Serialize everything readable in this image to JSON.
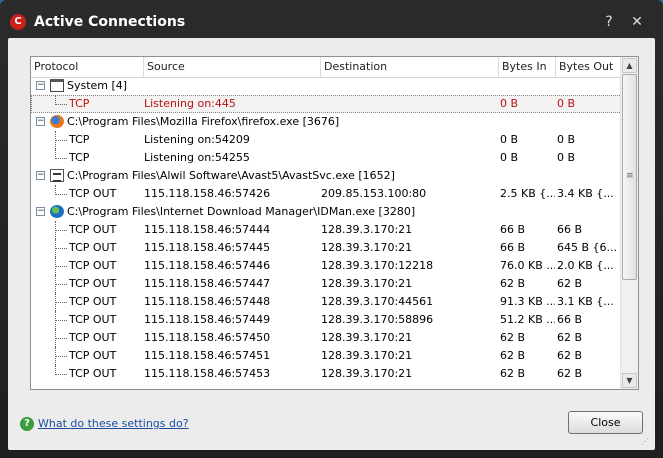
{
  "window": {
    "title": "Active Connections",
    "app_icon": "comodo-c-icon"
  },
  "columns": [
    "Protocol",
    "Source",
    "Destination",
    "Bytes In",
    "Bytes Out"
  ],
  "groups": [
    {
      "icon": "window-icon",
      "name": "System [4]",
      "rows": [
        {
          "protocol": "TCP",
          "source": "Listening on:445",
          "destination": "",
          "bytes_in": "0 B",
          "bytes_out": "0 B",
          "selected": true
        }
      ]
    },
    {
      "icon": "firefox-icon",
      "name": "C:\\Program Files\\Mozilla Firefox\\firefox.exe [3676]",
      "rows": [
        {
          "protocol": "TCP",
          "source": "Listening on:54209",
          "destination": "",
          "bytes_in": "0 B",
          "bytes_out": "0 B"
        },
        {
          "protocol": "TCP",
          "source": "Listening on:54255",
          "destination": "",
          "bytes_in": "0 B",
          "bytes_out": "0 B"
        }
      ]
    },
    {
      "icon": "avast-icon",
      "name": "C:\\Program Files\\Alwil Software\\Avast5\\AvastSvc.exe [1652]",
      "rows": [
        {
          "protocol": "TCP OUT",
          "source": "115.118.158.46:57426",
          "destination": "209.85.153.100:80",
          "bytes_in": "2.5 KB {...",
          "bytes_out": "3.4 KB {..."
        }
      ]
    },
    {
      "icon": "idm-icon",
      "name": "C:\\Program Files\\Internet Download Manager\\IDMan.exe [3280]",
      "rows": [
        {
          "protocol": "TCP OUT",
          "source": "115.118.158.46:57444",
          "destination": "128.39.3.170:21",
          "bytes_in": "66 B",
          "bytes_out": "66 B"
        },
        {
          "protocol": "TCP OUT",
          "source": "115.118.158.46:57445",
          "destination": "128.39.3.170:21",
          "bytes_in": "66 B",
          "bytes_out": "645 B {6..."
        },
        {
          "protocol": "TCP OUT",
          "source": "115.118.158.46:57446",
          "destination": "128.39.3.170:12218",
          "bytes_in": "76.0 KB ...",
          "bytes_out": "2.0 KB {..."
        },
        {
          "protocol": "TCP OUT",
          "source": "115.118.158.46:57447",
          "destination": "128.39.3.170:21",
          "bytes_in": "62 B",
          "bytes_out": "62 B"
        },
        {
          "protocol": "TCP OUT",
          "source": "115.118.158.46:57448",
          "destination": "128.39.3.170:44561",
          "bytes_in": "91.3 KB ...",
          "bytes_out": "3.1 KB {..."
        },
        {
          "protocol": "TCP OUT",
          "source": "115.118.158.46:57449",
          "destination": "128.39.3.170:58896",
          "bytes_in": "51.2 KB ...",
          "bytes_out": "66 B"
        },
        {
          "protocol": "TCP OUT",
          "source": "115.118.158.46:57450",
          "destination": "128.39.3.170:21",
          "bytes_in": "62 B",
          "bytes_out": "62 B"
        },
        {
          "protocol": "TCP OUT",
          "source": "115.118.158.46:57451",
          "destination": "128.39.3.170:21",
          "bytes_in": "62 B",
          "bytes_out": "62 B"
        },
        {
          "protocol": "TCP OUT",
          "source": "115.118.158.46:57453",
          "destination": "128.39.3.170:21",
          "bytes_in": "62 B",
          "bytes_out": "62 B"
        }
      ]
    }
  ],
  "footer": {
    "help_text": "What do these settings do?",
    "close_label": "Close"
  },
  "colors": {
    "selected_text": "#b11111",
    "link": "#1a4fa0",
    "titlebar": "#222222"
  }
}
